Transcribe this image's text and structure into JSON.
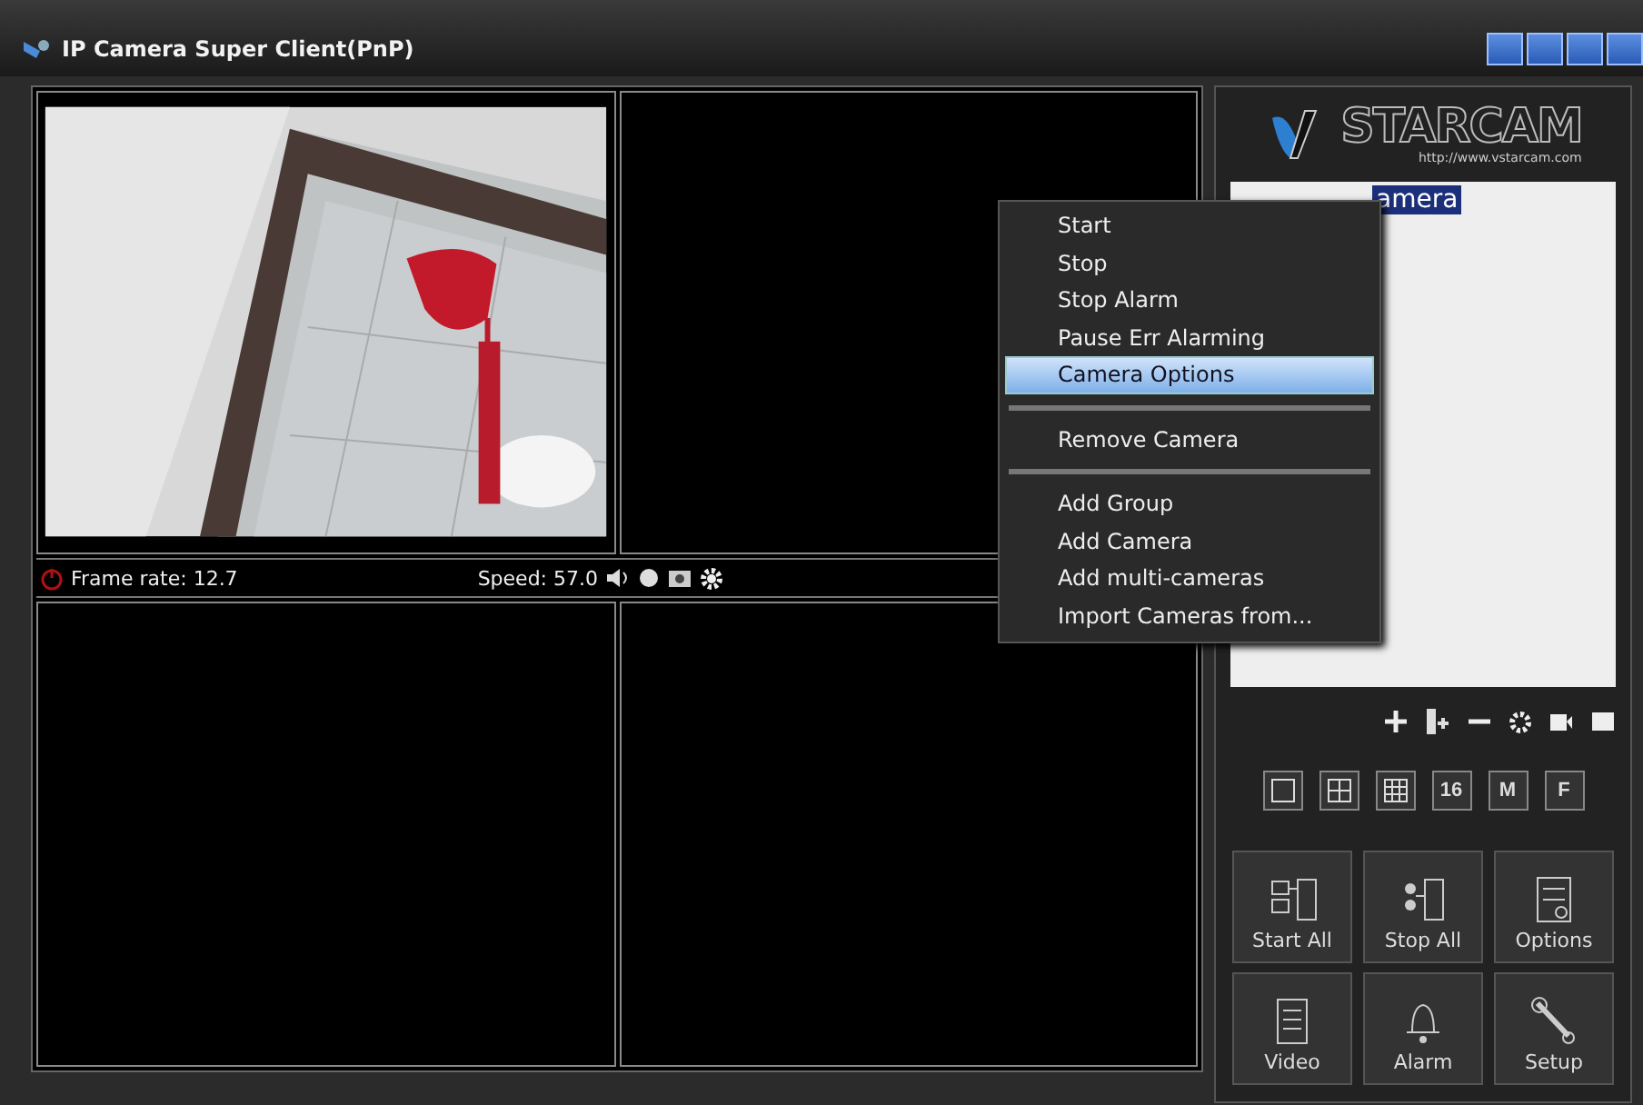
{
  "window": {
    "title": "IP Camera Super Client(PnP)"
  },
  "video_grid": {
    "cells": [
      {
        "kind": "picture"
      },
      {
        "kind": "empty"
      },
      {
        "kind": "empty"
      },
      {
        "kind": "empty"
      }
    ],
    "status": {
      "frame_rate": "Frame rate: 12.7",
      "speed": "Speed: 57.0"
    }
  },
  "logo": {
    "brand": "STARCAM",
    "url": "http://www.vstarcam.com"
  },
  "tree": {
    "items": [
      {
        "label": "amera",
        "selected": true
      }
    ]
  },
  "layout_buttons": [
    {
      "kind": "single"
    },
    {
      "kind": "quad"
    },
    {
      "kind": "nine"
    },
    {
      "kind": "text",
      "label": "16"
    },
    {
      "kind": "text",
      "label": "M"
    },
    {
      "kind": "text",
      "label": "F"
    }
  ],
  "action_buttons": [
    {
      "label": "Start All",
      "kind": "start"
    },
    {
      "label": "Stop All",
      "kind": "stop"
    },
    {
      "label": "Options",
      "kind": "options"
    },
    {
      "label": "Video",
      "kind": "video"
    },
    {
      "label": "Alarm",
      "kind": "alarm"
    },
    {
      "label": "Setup",
      "kind": "setup"
    }
  ],
  "context_menu": {
    "items": [
      {
        "kind": "item",
        "label": "Start",
        "selected": false
      },
      {
        "kind": "item",
        "label": "Stop",
        "selected": false
      },
      {
        "kind": "item",
        "label": "Stop Alarm",
        "selected": false
      },
      {
        "kind": "item",
        "label": "Pause Err Alarming",
        "selected": false
      },
      {
        "kind": "item",
        "label": "Camera Options",
        "selected": true
      },
      {
        "kind": "separator"
      },
      {
        "kind": "item",
        "label": "Remove Camera",
        "selected": false
      },
      {
        "kind": "separator"
      },
      {
        "kind": "item",
        "label": "Add Group",
        "selected": false
      },
      {
        "kind": "item",
        "label": "Add Camera",
        "selected": false
      },
      {
        "kind": "item",
        "label": "Add multi-cameras",
        "selected": false
      },
      {
        "kind": "item",
        "label": "Import Cameras from...",
        "selected": false
      }
    ]
  }
}
